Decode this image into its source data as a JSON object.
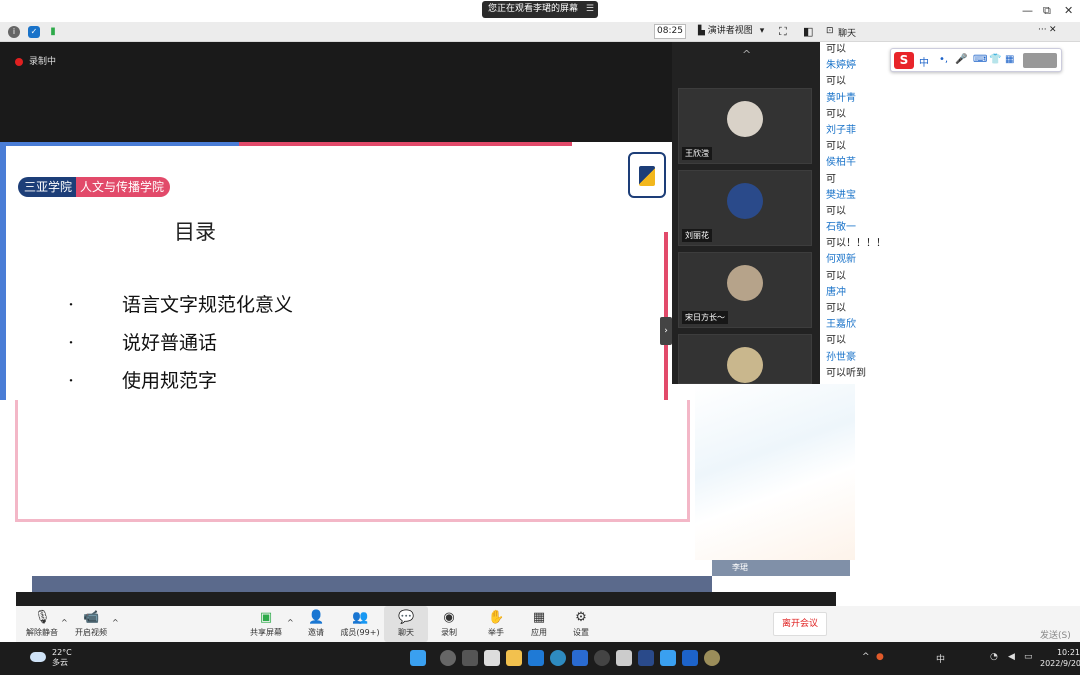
{
  "window": {
    "sharing_banner": "您正在观看李珺的屏幕",
    "minimize": "—",
    "restore": "⧉",
    "close": "✕"
  },
  "toolbar": {
    "timer": "08:25",
    "view_label": "演讲者视图",
    "view_caret": "▾"
  },
  "recording": {
    "label": "录制中"
  },
  "slide": {
    "college_a": "三亚学院",
    "college_b": "人文与传播学院",
    "title": "目录",
    "bullets": [
      "语言文字规范化意义",
      "说好普通话",
      "使用规范字"
    ],
    "bullet_glyph": "·"
  },
  "participants": {
    "scroll_up": "^",
    "collapse": "›",
    "tiles": [
      {
        "name": "王欣滢",
        "color": "#d9d2c8"
      },
      {
        "name": "刘丽花",
        "color": "#2a4a8a"
      },
      {
        "name": "宋日方长～",
        "color": "#b6a38a"
      },
      {
        "name": "",
        "color": "#c9b78d"
      }
    ],
    "name_strip": "李珺"
  },
  "chat": {
    "title": "聊天",
    "more": "···",
    "close": "✕",
    "ime_logo": "S",
    "ime_mode": "中",
    "messages": [
      {
        "type": "text",
        "text": "可以"
      },
      {
        "type": "name",
        "text": "朱婷婷"
      },
      {
        "type": "text",
        "text": "可以"
      },
      {
        "type": "name",
        "text": "黄叶青"
      },
      {
        "type": "text",
        "text": "可以"
      },
      {
        "type": "name",
        "text": "刘子菲"
      },
      {
        "type": "text",
        "text": "可以"
      },
      {
        "type": "name",
        "text": "侯柏芊"
      },
      {
        "type": "text",
        "text": "可"
      },
      {
        "type": "name",
        "text": "樊进宝"
      },
      {
        "type": "text",
        "text": "可以"
      },
      {
        "type": "name",
        "text": "石敬一"
      },
      {
        "type": "text",
        "text": "可以！！！！"
      },
      {
        "type": "name",
        "text": "何观新"
      },
      {
        "type": "text",
        "text": "可以"
      },
      {
        "type": "name",
        "text": "唐冲"
      },
      {
        "type": "text",
        "text": "可以"
      },
      {
        "type": "name",
        "text": "王嘉欣"
      },
      {
        "type": "text",
        "text": "可以"
      },
      {
        "type": "name",
        "text": "孙世豪"
      },
      {
        "type": "text",
        "text": "可以听到"
      }
    ],
    "send": "发送(S)"
  },
  "controls": {
    "mute": {
      "icon": "mic-off-icon",
      "glyph": "🎙",
      "label": "解除静音"
    },
    "video": {
      "icon": "camera-icon",
      "glyph": "📹",
      "label": "开启视频"
    },
    "share": {
      "icon": "share-screen-icon",
      "glyph": "▣",
      "label": "共享屏幕"
    },
    "invite": {
      "icon": "invite-icon",
      "glyph": "👤",
      "label": "邀请"
    },
    "members": {
      "icon": "members-icon",
      "glyph": "👥",
      "label": "成员(99+)"
    },
    "chat": {
      "icon": "chat-icon",
      "glyph": "💬",
      "label": "聊天"
    },
    "record": {
      "icon": "record-icon",
      "glyph": "◉",
      "label": "录制"
    },
    "raise": {
      "icon": "raise-hand-icon",
      "glyph": "✋",
      "label": "举手"
    },
    "apps": {
      "icon": "apps-icon",
      "glyph": "▦",
      "label": "应用"
    },
    "settings": {
      "icon": "gear-icon",
      "glyph": "⚙",
      "label": "设置"
    },
    "caret": "^",
    "leave": "离开会议"
  },
  "taskbar": {
    "temperature": "22°C",
    "condition": "多云",
    "ime": "中",
    "time": "10:21",
    "date": "2022/9/20",
    "tray_caret": "^"
  },
  "colors": {
    "brand_blue": "#1d3e78",
    "brand_pink": "#e24a6a",
    "chat_name": "#1a73c9",
    "leave_red": "#e02020"
  }
}
